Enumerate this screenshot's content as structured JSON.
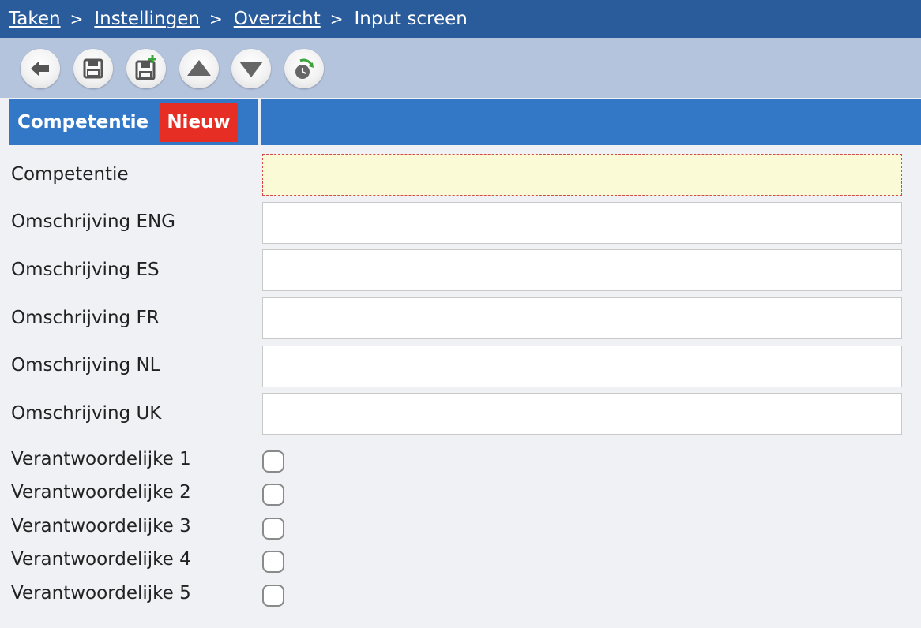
{
  "breadcrumb": {
    "items": [
      "Taken",
      "Instellingen",
      "Overzicht"
    ],
    "current": "Input screen",
    "separator": ">"
  },
  "toolbar": {
    "buttons": [
      "back-icon",
      "save-icon",
      "save-new-icon",
      "up-arrow-icon",
      "down-arrow-icon",
      "history-icon"
    ]
  },
  "header": {
    "title": "Competentie",
    "badge": "Nieuw"
  },
  "form": {
    "fields": [
      {
        "label": "Competentie",
        "value": "",
        "required": true
      },
      {
        "label": "Omschrijving ENG",
        "value": ""
      },
      {
        "label": "Omschrijving ES",
        "value": ""
      },
      {
        "label": "Omschrijving FR",
        "value": ""
      },
      {
        "label": "Omschrijving NL",
        "value": ""
      },
      {
        "label": "Omschrijving UK",
        "value": ""
      }
    ],
    "checkboxes": [
      {
        "label": "Verantwoordelijke 1",
        "checked": false
      },
      {
        "label": "Verantwoordelijke 2",
        "checked": false
      },
      {
        "label": "Verantwoordelijke 3",
        "checked": false
      },
      {
        "label": "Verantwoordelijke 4",
        "checked": false
      },
      {
        "label": "Verantwoordelijke 5",
        "checked": false
      }
    ]
  },
  "colors": {
    "breadcrumb_bg": "#2a5b9b",
    "toolbar_bg": "#b5c4dd",
    "header_bg": "#3378c6",
    "badge_bg": "#e62e24",
    "required_bg": "#fafad7"
  }
}
